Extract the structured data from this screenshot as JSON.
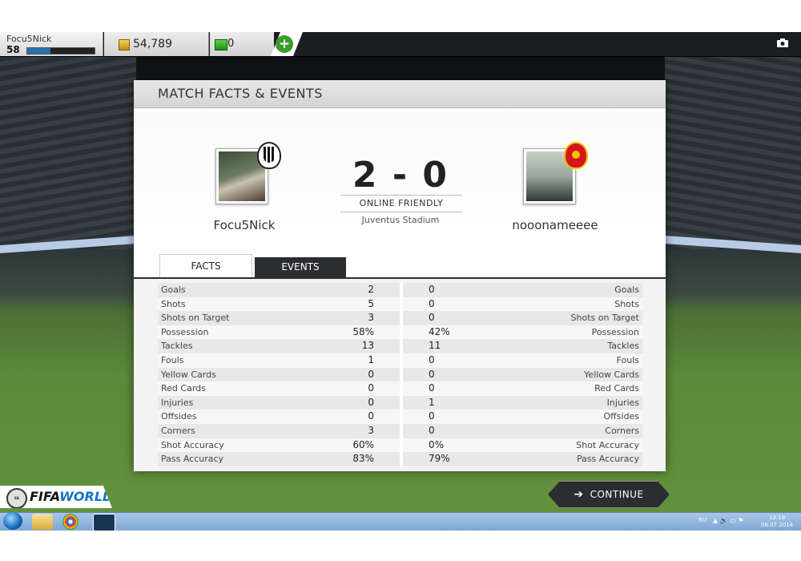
{
  "header": {
    "player_name": "Focu5Nick",
    "level": "58",
    "xp_progress": 0.35,
    "coins": "54,789",
    "fifa_points": "0",
    "add_label": "+"
  },
  "panel": {
    "title": "MATCH FACTS & EVENTS"
  },
  "match": {
    "home_team": "Focu5Nick",
    "away_team": "nooonameeee",
    "score": "2 - 0",
    "match_type": "ONLINE FRIENDLY",
    "stadium": "Juventus Stadium",
    "home_badge": "juventus-crest",
    "away_badge": "manchester-united-crest"
  },
  "tabs": {
    "facts": "FACTS",
    "events": "EVENTS"
  },
  "stats": [
    {
      "label": "Goals",
      "home": "2",
      "away": "0"
    },
    {
      "label": "Shots",
      "home": "5",
      "away": "0"
    },
    {
      "label": "Shots on Target",
      "home": "3",
      "away": "0"
    },
    {
      "label": "Possession",
      "home": "58%",
      "away": "42%"
    },
    {
      "label": "Tackles",
      "home": "13",
      "away": "11"
    },
    {
      "label": "Fouls",
      "home": "1",
      "away": "0"
    },
    {
      "label": "Yellow Cards",
      "home": "0",
      "away": "0"
    },
    {
      "label": "Red Cards",
      "home": "0",
      "away": "0"
    },
    {
      "label": "Injuries",
      "home": "0",
      "away": "1"
    },
    {
      "label": "Offsides",
      "home": "0",
      "away": "0"
    },
    {
      "label": "Corners",
      "home": "3",
      "away": "0"
    },
    {
      "label": "Shot Accuracy",
      "home": "60%",
      "away": "0%"
    },
    {
      "label": "Pass Accuracy",
      "home": "83%",
      "away": "79%"
    }
  ],
  "continue_label": "CONTINUE",
  "logo": {
    "ea": "EA SPORTS",
    "fifa": "FIFA",
    "world": "WORLD"
  },
  "taskbar": {
    "lang": "RU",
    "time": "13:19",
    "date": "06.07.2014"
  },
  "colors": {
    "panel_bg": "#f3f3f3",
    "dark_button": "#2b2d30",
    "accent_green": "#3c9a2f",
    "xp_blue": "#2a6fb3"
  }
}
